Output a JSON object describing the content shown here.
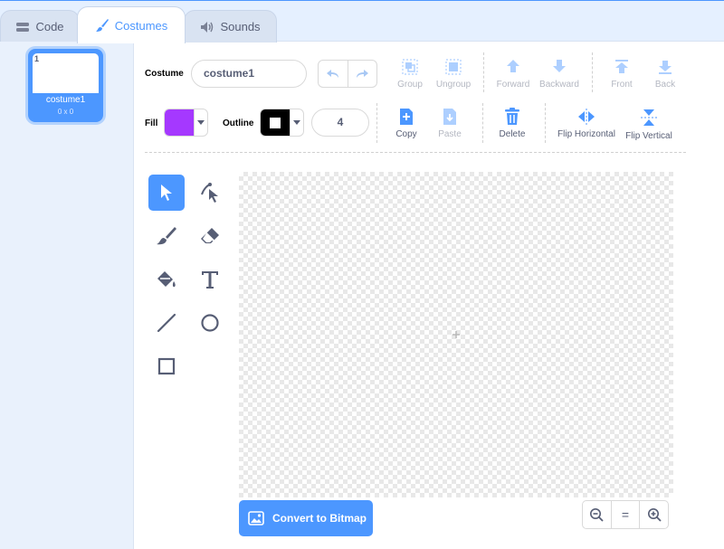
{
  "tabs": [
    {
      "label": "Code",
      "icon": "code-icon"
    },
    {
      "label": "Costumes",
      "icon": "brush-icon",
      "active": true
    },
    {
      "label": "Sounds",
      "icon": "speaker-icon"
    }
  ],
  "costumes": [
    {
      "number": "1",
      "name": "costume1",
      "size": "0 x 0",
      "selected": true
    }
  ],
  "toolbar": {
    "costume_label": "Costume",
    "costume_name": "costume1",
    "fill_label": "Fill",
    "fill_color": "#a538ff",
    "outline_label": "Outline",
    "outline_color": "#000000",
    "outline_width": "4",
    "group": "Group",
    "ungroup": "Ungroup",
    "forward": "Forward",
    "backward": "Backward",
    "front": "Front",
    "back": "Back",
    "copy": "Copy",
    "paste": "Paste",
    "delete": "Delete",
    "flip_horizontal": "Flip Horizontal",
    "flip_vertical": "Flip Vertical"
  },
  "tools": [
    "select-tool",
    "reshape-tool",
    "brush-tool",
    "eraser-tool",
    "fill-tool",
    "text-tool",
    "line-tool",
    "circle-tool",
    "rectangle-tool"
  ],
  "active_tool": "select-tool",
  "convert_button": "Convert to Bitmap",
  "zoom": {
    "out": "zoom-out-icon",
    "reset": "=",
    "in": "zoom-in-icon"
  },
  "colors": {
    "accent": "#4c97ff",
    "text": "#575e75"
  }
}
